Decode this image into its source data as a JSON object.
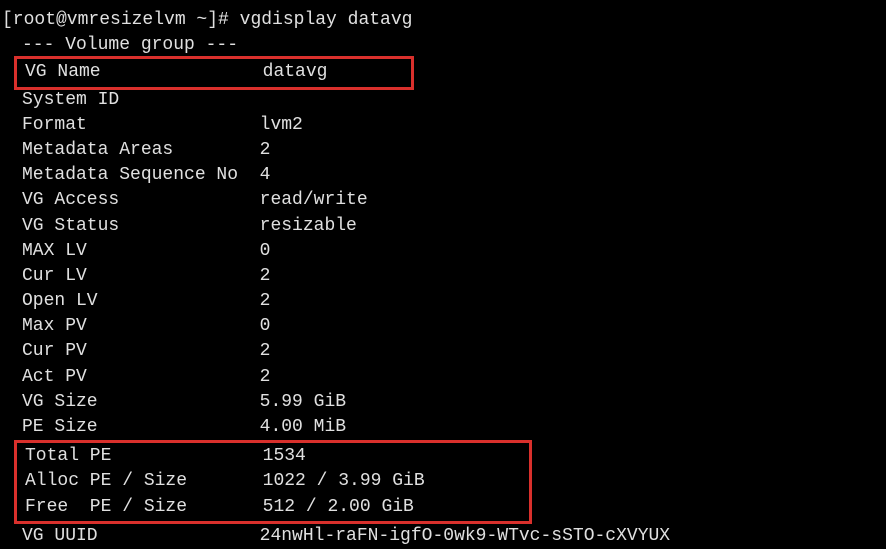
{
  "prompt": {
    "full": "[root@vmresizelvm ~]# vgdisplay datavg"
  },
  "header": "--- Volume group ---",
  "fields": {
    "vg_name": "VG Name               datavg",
    "system_id": "System ID",
    "format": "Format                lvm2",
    "meta_areas": "Metadata Areas        2",
    "meta_seq": "Metadata Sequence No  4",
    "vg_access": "VG Access             read/write",
    "vg_status": "VG Status             resizable",
    "max_lv": "MAX LV                0",
    "cur_lv": "Cur LV                2",
    "open_lv": "Open LV               2",
    "max_pv": "Max PV                0",
    "cur_pv": "Cur PV                2",
    "act_pv": "Act PV                2",
    "vg_size": "VG Size               5.99 GiB",
    "pe_size": "PE Size               4.00 MiB",
    "total_pe": "Total PE              1534",
    "alloc_pe": "Alloc PE / Size       1022 / 3.99 GiB",
    "free_pe": "Free  PE / Size       512 / 2.00 GiB",
    "vg_uuid": "VG UUID               24nwHl-raFN-igfO-0wk9-WTvc-sSTO-cXVYUX"
  }
}
